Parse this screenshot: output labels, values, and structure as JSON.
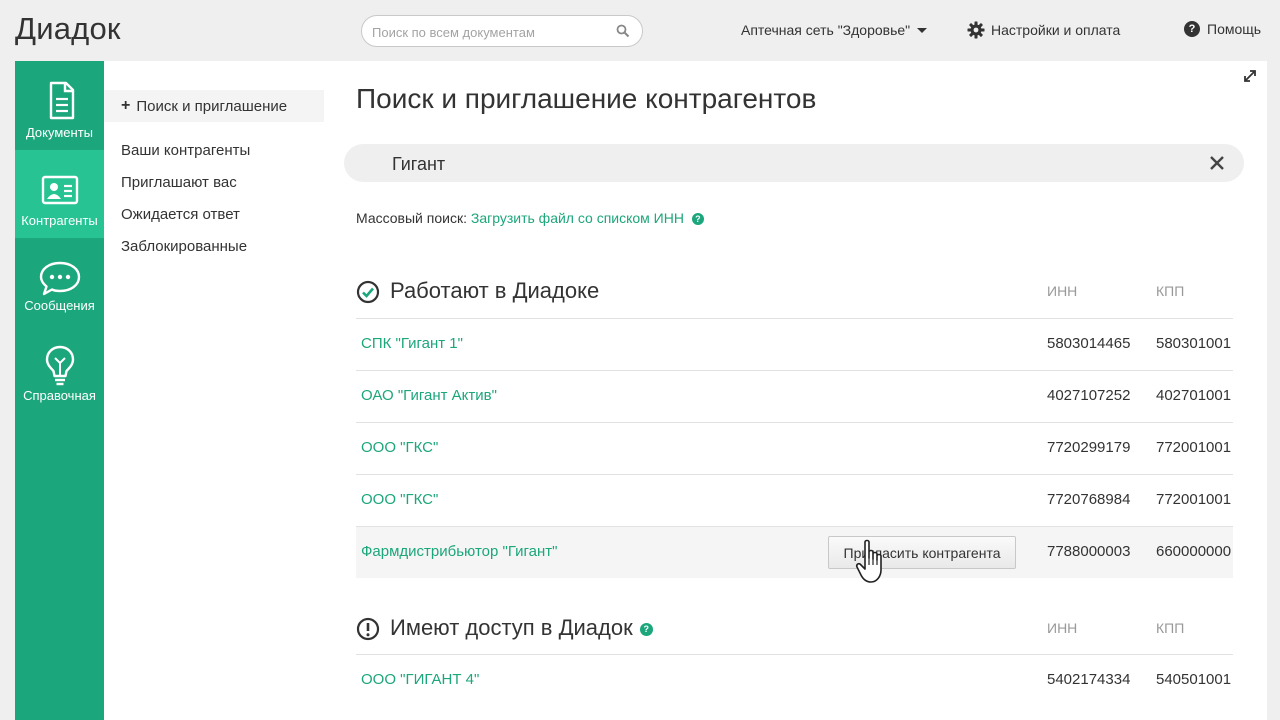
{
  "header": {
    "logo": "Диадок",
    "search_placeholder": "Поиск по всем документам",
    "organization": "Аптечная сеть \"Здоровье\"",
    "settings_label": "Настройки и оплата",
    "help_label": "Помощь"
  },
  "leftnav": {
    "items": [
      {
        "label": "Документы",
        "icon": "document-icon"
      },
      {
        "label": "Контрагенты",
        "icon": "contact-card-icon",
        "active": true
      },
      {
        "label": "Сообщения",
        "icon": "chat-bubble-icon"
      },
      {
        "label": "Справочная",
        "icon": "lightbulb-icon"
      }
    ]
  },
  "subnav": {
    "primary": "Поиск и приглашение",
    "items": [
      "Ваши контрагенты",
      "Приглашают вас",
      "Ожидается ответ",
      "Заблокированные"
    ]
  },
  "main": {
    "title": "Поиск и приглашение контрагентов",
    "query": "Гигант",
    "mass_search_label": "Массовый поиск:",
    "mass_search_link": "Загрузить файл со списком ИНН",
    "mass_search_hint": "?",
    "section1": {
      "title": "Работают в Диадоке",
      "col_inn": "ИНН",
      "col_kpp": "КПП",
      "rows": [
        {
          "name": "СПК \"Гигант 1\"",
          "inn": "5803014465",
          "kpp": "580301001"
        },
        {
          "name": "ОАО \"Гигант Актив\"",
          "inn": "4027107252",
          "kpp": "402701001"
        },
        {
          "name": "ООО \"ГКС\"",
          "inn": "7720299179",
          "kpp": "772001001"
        },
        {
          "name": "ООО \"ГКС\"",
          "inn": "7720768984",
          "kpp": "772001001"
        },
        {
          "name": "Фармдистрибьютор \"Гигант\"",
          "inn": "7788000003",
          "kpp": "660000000",
          "invite_label": "Пригласить контрагента"
        }
      ]
    },
    "section2": {
      "title": "Имеют доступ в Диадок",
      "hint": "?",
      "col_inn": "ИНН",
      "col_kpp": "КПП",
      "rows": [
        {
          "name": "ООО \"ГИГАНТ 4\"",
          "inn": "5402174334",
          "kpp": "540501001"
        }
      ]
    }
  },
  "colors": {
    "accent": "#1ca67b",
    "accent_active": "#27c392",
    "background": "#efefef"
  }
}
